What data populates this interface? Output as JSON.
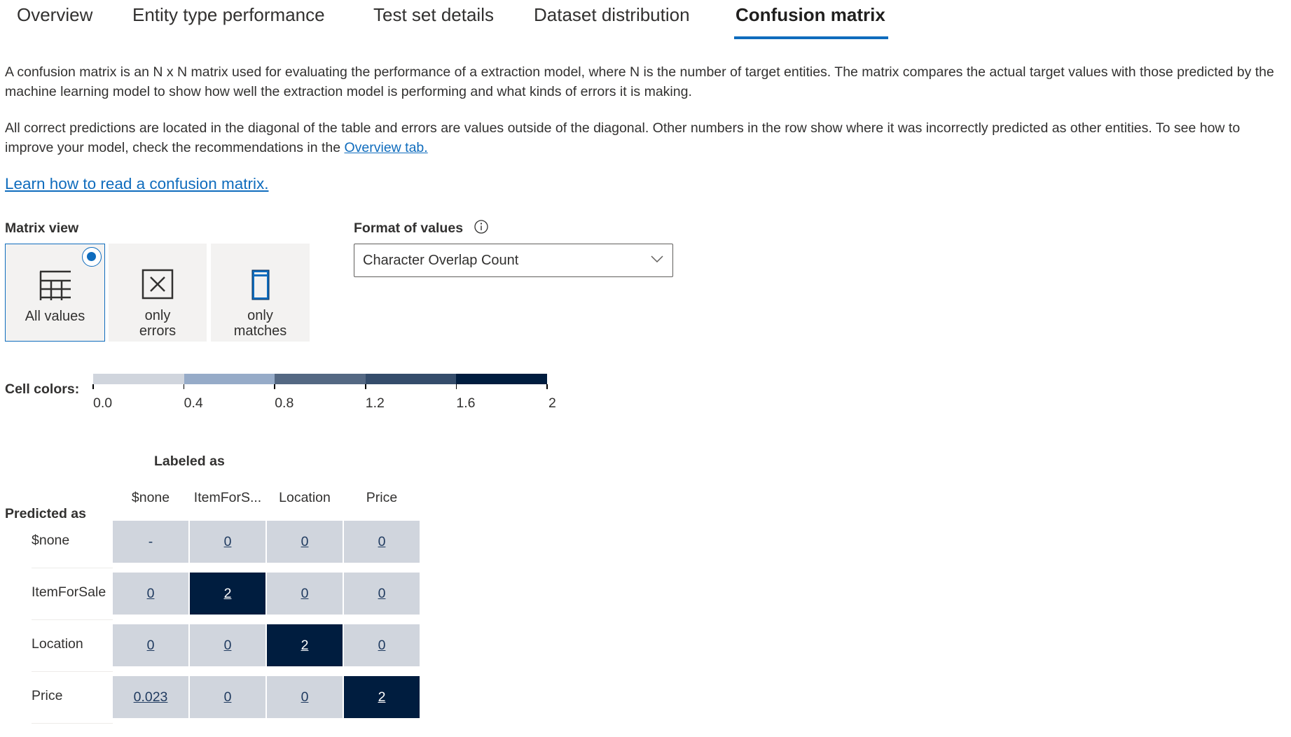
{
  "tabs": [
    {
      "label": "Overview",
      "active": false
    },
    {
      "label": "Entity type performance",
      "active": false
    },
    {
      "label": "Test set details",
      "active": false
    },
    {
      "label": "Dataset distribution",
      "active": false
    },
    {
      "label": "Confusion matrix",
      "active": true
    }
  ],
  "description": {
    "para1": "A confusion matrix is an N x N matrix used for evaluating the performance of a extraction model, where N is the number of target entities. The matrix compares the actual target values with those predicted by the machine learning model to show how well the extraction model is performing and what kinds of errors it is making.",
    "para2_text": "All correct predictions are located in the diagonal of the table and errors are values outside of the diagonal. Other numbers in the row show where it was incorrectly predicted as other entities. To see how to improve your model, check the recommendations in the ",
    "para2_link": "Overview tab.",
    "learn_link": "Learn how to read a confusion matrix."
  },
  "matrix_view": {
    "label": "Matrix view",
    "options": [
      {
        "label": "All values",
        "icon": "table-grid-icon",
        "selected": true
      },
      {
        "label_line1": "only",
        "label_line2": "errors",
        "icon": "error-box-icon",
        "selected": false
      },
      {
        "label_line1": "only",
        "label_line2": "matches",
        "icon": "match-column-icon",
        "selected": false
      }
    ]
  },
  "format_of_values": {
    "label": "Format of values",
    "info_icon": "info-icon",
    "selected": "Character Overlap Count"
  },
  "cell_colors": {
    "label": "Cell colors:",
    "ticks": [
      "0.0",
      "0.4",
      "0.8",
      "1.2",
      "1.6",
      "2"
    ],
    "colors": [
      "#d0d5dd",
      "#96abc8",
      "#546883",
      "#344c6b",
      "#001d3f"
    ]
  },
  "matrix": {
    "labeled_as": "Labeled as",
    "predicted_as": "Predicted as",
    "columns": [
      "$none",
      "ItemForS...",
      "Location",
      "Price"
    ],
    "rows": [
      {
        "label": "$none",
        "values": [
          "-",
          "0",
          "0",
          "0"
        ]
      },
      {
        "label": "ItemForSale",
        "values": [
          "0",
          "2",
          "0",
          "0"
        ]
      },
      {
        "label": "Location",
        "values": [
          "0",
          "0",
          "2",
          "0"
        ]
      },
      {
        "label": "Price",
        "values": [
          "0.023",
          "0",
          "0",
          "2"
        ]
      }
    ],
    "light_color": "#d0d5dd",
    "dark_color": "#001d3f",
    "light_text": "#1f3a5f",
    "dark_text": "#ffffff"
  }
}
